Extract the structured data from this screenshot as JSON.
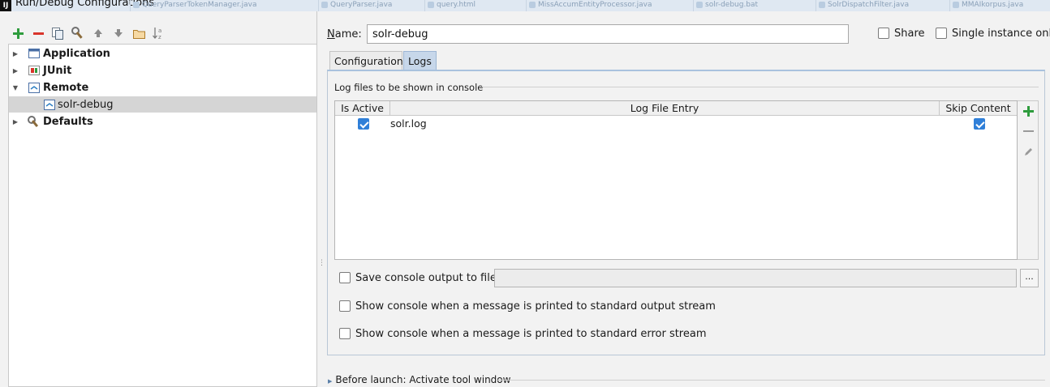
{
  "window": {
    "title": "Run/Debug Configurations",
    "logo": "IJ",
    "background_tabs": [
      "QueryParserTokenManager.java",
      "QueryParser.java",
      "query.html",
      "MissAccumEntityProcessor.java",
      "solr-debug.bat",
      "SolrDispatchFilter.java",
      "MMAIkorpus.java"
    ]
  },
  "toolbar": {
    "icons": [
      "add-icon",
      "remove-icon",
      "copy-icon",
      "edit-defaults-icon",
      "move-up-icon",
      "move-down-icon",
      "folder-icon",
      "sort-icon"
    ]
  },
  "tree": {
    "items": [
      {
        "label": "Application",
        "bold": true,
        "icon": "application-icon",
        "expanded": false
      },
      {
        "label": "JUnit",
        "bold": true,
        "icon": "junit-icon",
        "expanded": false
      },
      {
        "label": "Remote",
        "bold": true,
        "icon": "remote-icon",
        "expanded": true
      },
      {
        "label": "solr-debug",
        "bold": false,
        "icon": "remote-config-icon",
        "selected": true
      },
      {
        "label": "Defaults",
        "bold": true,
        "icon": "wrench-icon",
        "expanded": false
      }
    ]
  },
  "form": {
    "name_label": "Name:",
    "name_value": "solr-debug",
    "share_label": "Share",
    "single_instance_label": "Single instance only"
  },
  "tabs": [
    {
      "label": "Configuration",
      "active": false
    },
    {
      "label": "Logs",
      "active": true
    }
  ],
  "logs": {
    "section_title": "Log files to be shown in console",
    "columns": [
      "Is Active",
      "Log File Entry",
      "Skip Content"
    ],
    "rows": [
      {
        "is_active": true,
        "entry": "solr.log",
        "skip_content": true
      }
    ],
    "save_output_label": "Save console output to file:",
    "save_output_value": "",
    "browse_label": "...",
    "show_stdout_label": "Show console when a message is printed to standard output stream",
    "show_stderr_label": "Show console when a message is printed to standard error stream"
  },
  "before_launch": {
    "label": "Before launch: Activate tool window"
  },
  "colors": {
    "add": "#2e9c3d",
    "remove": "#d9352b",
    "checkbox": "#2f7fd8",
    "active_tab": "#c7d7ea",
    "selected_row": "#d5d5d5"
  }
}
